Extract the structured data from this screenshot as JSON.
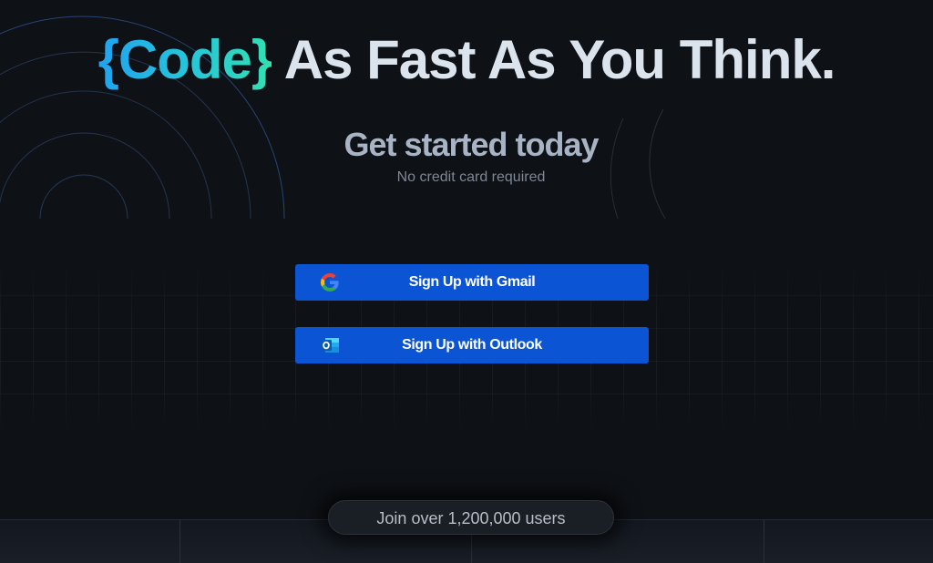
{
  "hero": {
    "brand": "{Code}",
    "title_rest": "As Fast As You Think."
  },
  "subtitle": "Get started today",
  "subnote": "No credit card required",
  "buttons": {
    "gmail_label": "Sign Up with Gmail",
    "outlook_label": "Sign Up with Outlook"
  },
  "users_pill": "Join over 1,200,000 users",
  "colors": {
    "background": "#0e1116",
    "button": "#0b55d4",
    "brand_gradient_start": "#1fa3f0",
    "brand_gradient_end": "#32e0b0",
    "title_text": "#dbe3ec"
  },
  "icons": {
    "gmail": "google-icon",
    "outlook": "outlook-icon"
  }
}
